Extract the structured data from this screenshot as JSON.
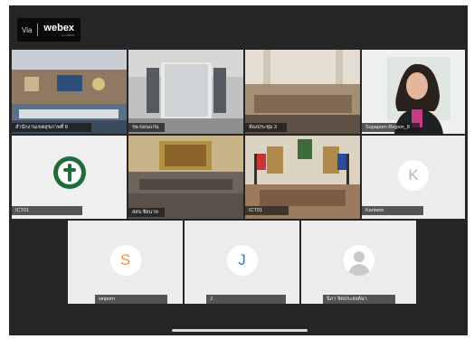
{
  "app": {
    "via_label": "Via",
    "brand_name": "webex",
    "brand_by": "by CISCO"
  },
  "tiles": [
    {
      "label": "สำนักงานเขตสุขภาพที่ 8",
      "kind": "room"
    },
    {
      "label": "รพ.ขอนแก่น",
      "kind": "room"
    },
    {
      "label": "ห้องประชุม 3",
      "kind": "room"
    },
    {
      "label": "Supaporn Region_8",
      "kind": "person"
    },
    {
      "label": "ICT01",
      "kind": "logo"
    },
    {
      "label": "สสจ.ชัยนาท",
      "kind": "room"
    },
    {
      "label": "ICT01",
      "kind": "room"
    },
    {
      "label": "Kantarin",
      "kind": "avatar",
      "initial": "K"
    },
    {
      "label": "siriporn",
      "kind": "avatar",
      "initial": "S"
    },
    {
      "label": "J",
      "kind": "avatar",
      "initial": "J"
    },
    {
      "label": "นิภา จิตประสงค์นา",
      "kind": "silhouette"
    }
  ],
  "colors": {
    "background": "#262626",
    "tile_gray": "#ececec",
    "avatar_s": "#e8904a",
    "avatar_j": "#3a7fc1",
    "avatar_k": "#b5b5b5",
    "logo_green": "#1f6b3a"
  }
}
